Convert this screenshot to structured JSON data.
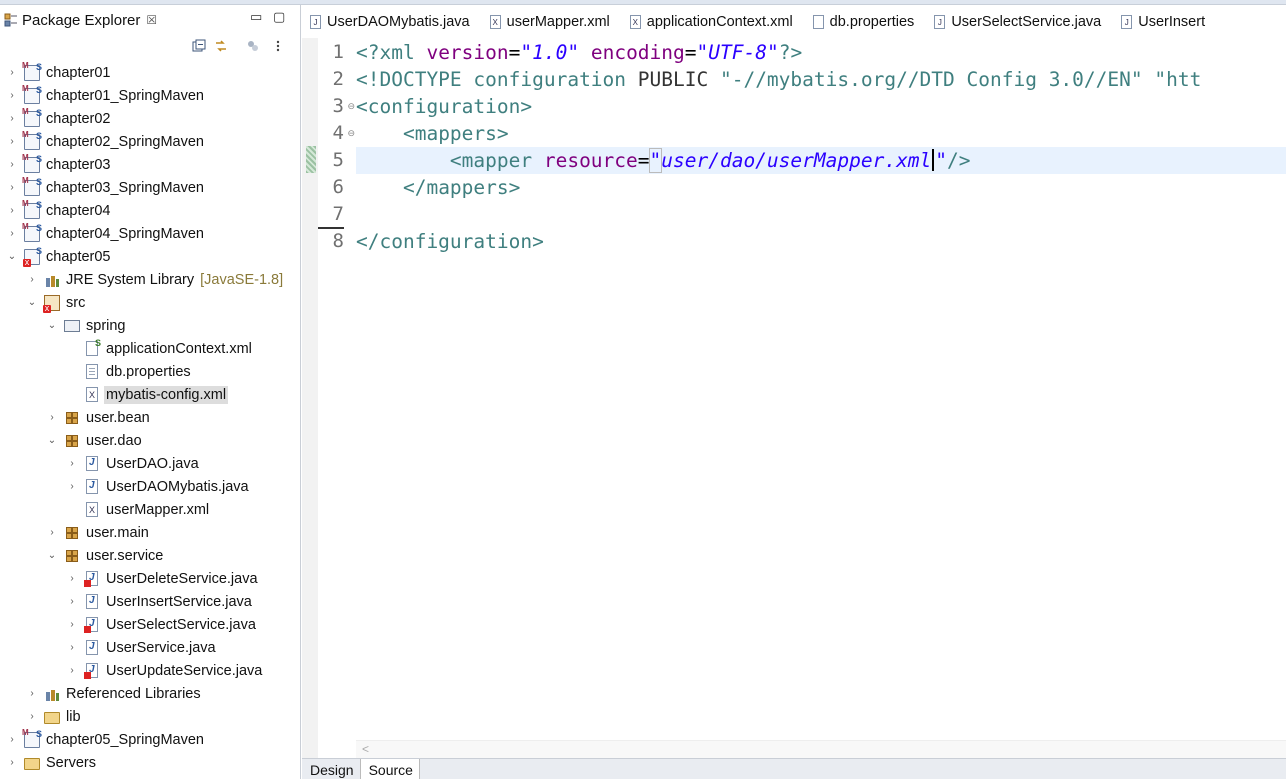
{
  "explorer": {
    "title": "Package Explorer",
    "close": "☒",
    "controls": {
      "minimize": "▭",
      "maximize": "▢"
    },
    "tree": [
      {
        "label": "chapter01",
        "depth": 0,
        "twisty": "›",
        "icon": "i-proj i-maven"
      },
      {
        "label": "chapter01_SpringMaven",
        "depth": 0,
        "twisty": "›",
        "icon": "i-proj i-maven"
      },
      {
        "label": "chapter02",
        "depth": 0,
        "twisty": "›",
        "icon": "i-proj i-maven"
      },
      {
        "label": "chapter02_SpringMaven",
        "depth": 0,
        "twisty": "›",
        "icon": "i-proj i-maven"
      },
      {
        "label": "chapter03",
        "depth": 0,
        "twisty": "›",
        "icon": "i-proj i-maven"
      },
      {
        "label": "chapter03_SpringMaven",
        "depth": 0,
        "twisty": "›",
        "icon": "i-proj i-maven"
      },
      {
        "label": "chapter04",
        "depth": 0,
        "twisty": "›",
        "icon": "i-proj i-maven"
      },
      {
        "label": "chapter04_SpringMaven",
        "depth": 0,
        "twisty": "›",
        "icon": "i-proj i-maven"
      },
      {
        "label": "chapter05",
        "depth": 0,
        "twisty": "⌄",
        "icon": "i-proj i-err"
      },
      {
        "label": "JRE System Library",
        "deco": "[JavaSE-1.8]",
        "depth": 1,
        "twisty": "›",
        "icon": "i-lib"
      },
      {
        "label": "src",
        "depth": 1,
        "twisty": "⌄",
        "icon": "i-src i-err"
      },
      {
        "label": "spring",
        "depth": 2,
        "twisty": "⌄",
        "icon": "i-pkgopen"
      },
      {
        "label": "applicationContext.xml",
        "depth": 3,
        "twisty": "",
        "icon": "i-sxml"
      },
      {
        "label": "db.properties",
        "depth": 3,
        "twisty": "",
        "icon": "i-file"
      },
      {
        "label": "mybatis-config.xml",
        "depth": 3,
        "twisty": "",
        "icon": "i-xml",
        "selected": true
      },
      {
        "label": "user.bean",
        "depth": 2,
        "twisty": "›",
        "icon": "i-pkg"
      },
      {
        "label": "user.dao",
        "depth": 2,
        "twisty": "⌄",
        "icon": "i-pkg"
      },
      {
        "label": "UserDAO.java",
        "depth": 3,
        "twisty": "›",
        "icon": "i-java"
      },
      {
        "label": "UserDAOMybatis.java",
        "depth": 3,
        "twisty": "›",
        "icon": "i-java"
      },
      {
        "label": "userMapper.xml",
        "depth": 3,
        "twisty": "",
        "icon": "i-xml"
      },
      {
        "label": "user.main",
        "depth": 2,
        "twisty": "›",
        "icon": "i-pkg"
      },
      {
        "label": "user.service",
        "depth": 2,
        "twisty": "⌄",
        "icon": "i-pkg i-err"
      },
      {
        "label": "UserDeleteService.java",
        "depth": 3,
        "twisty": "›",
        "icon": "i-java i-jerr"
      },
      {
        "label": "UserInsertService.java",
        "depth": 3,
        "twisty": "›",
        "icon": "i-java"
      },
      {
        "label": "UserSelectService.java",
        "depth": 3,
        "twisty": "›",
        "icon": "i-java i-jerr"
      },
      {
        "label": "UserService.java",
        "depth": 3,
        "twisty": "›",
        "icon": "i-java"
      },
      {
        "label": "UserUpdateService.java",
        "depth": 3,
        "twisty": "›",
        "icon": "i-java i-jerr"
      },
      {
        "label": "Referenced Libraries",
        "depth": 1,
        "twisty": "›",
        "icon": "i-lib"
      },
      {
        "label": "lib",
        "depth": 1,
        "twisty": "›",
        "icon": "i-folder"
      },
      {
        "label": "chapter05_SpringMaven",
        "depth": 0,
        "twisty": "›",
        "icon": "i-proj i-maven"
      },
      {
        "label": "Servers",
        "depth": 0,
        "twisty": "›",
        "icon": "i-folder"
      }
    ]
  },
  "editor": {
    "tabs": [
      {
        "label": "UserDAOMybatis.java",
        "icon": "J"
      },
      {
        "label": "userMapper.xml",
        "icon": "X"
      },
      {
        "label": "applicationContext.xml",
        "icon": "X"
      },
      {
        "label": "db.properties",
        "icon": ""
      },
      {
        "label": "UserSelectService.java",
        "icon": "J"
      },
      {
        "label": "UserInsert",
        "icon": "J"
      }
    ],
    "line_numbers": [
      "1",
      "2",
      "3",
      "4",
      "5",
      "6",
      "7",
      "8"
    ],
    "fold_markers": {
      "3": "⊖",
      "4": "⊖"
    },
    "current_line": 5,
    "scroll_arrow": "<",
    "bottom_tabs": {
      "design": "Design",
      "source": "Source"
    }
  },
  "code": {
    "l1": {
      "open": "<?xml ",
      "a1": "version",
      "eq1": "=",
      "v1": "\"1.0\"",
      "sp": " ",
      "a2": "encoding",
      "eq2": "=",
      "v2": "\"UTF-8\"",
      "close": "?>"
    },
    "l2": {
      "open": "<!DOCTYPE ",
      "name": "configuration ",
      "kw": "PUBLIC ",
      "id": "\"-//mybatis.org//DTD Config 3.0//EN\" ",
      "sys": "\"htt"
    },
    "l3": {
      "tag": "<configuration>"
    },
    "l4": {
      "indent": "    ",
      "tag": "<mappers>"
    },
    "l5": {
      "indent": "        ",
      "open": "<mapper ",
      "attr": "resource",
      "eq": "=",
      "q1": "\"",
      "val": "user/dao/userMapper.xml",
      "q2": "\"",
      "close": "/>"
    },
    "l6": {
      "indent": "    ",
      "tag": "</mappers>"
    },
    "l8": {
      "tag": "</configuration>"
    }
  }
}
